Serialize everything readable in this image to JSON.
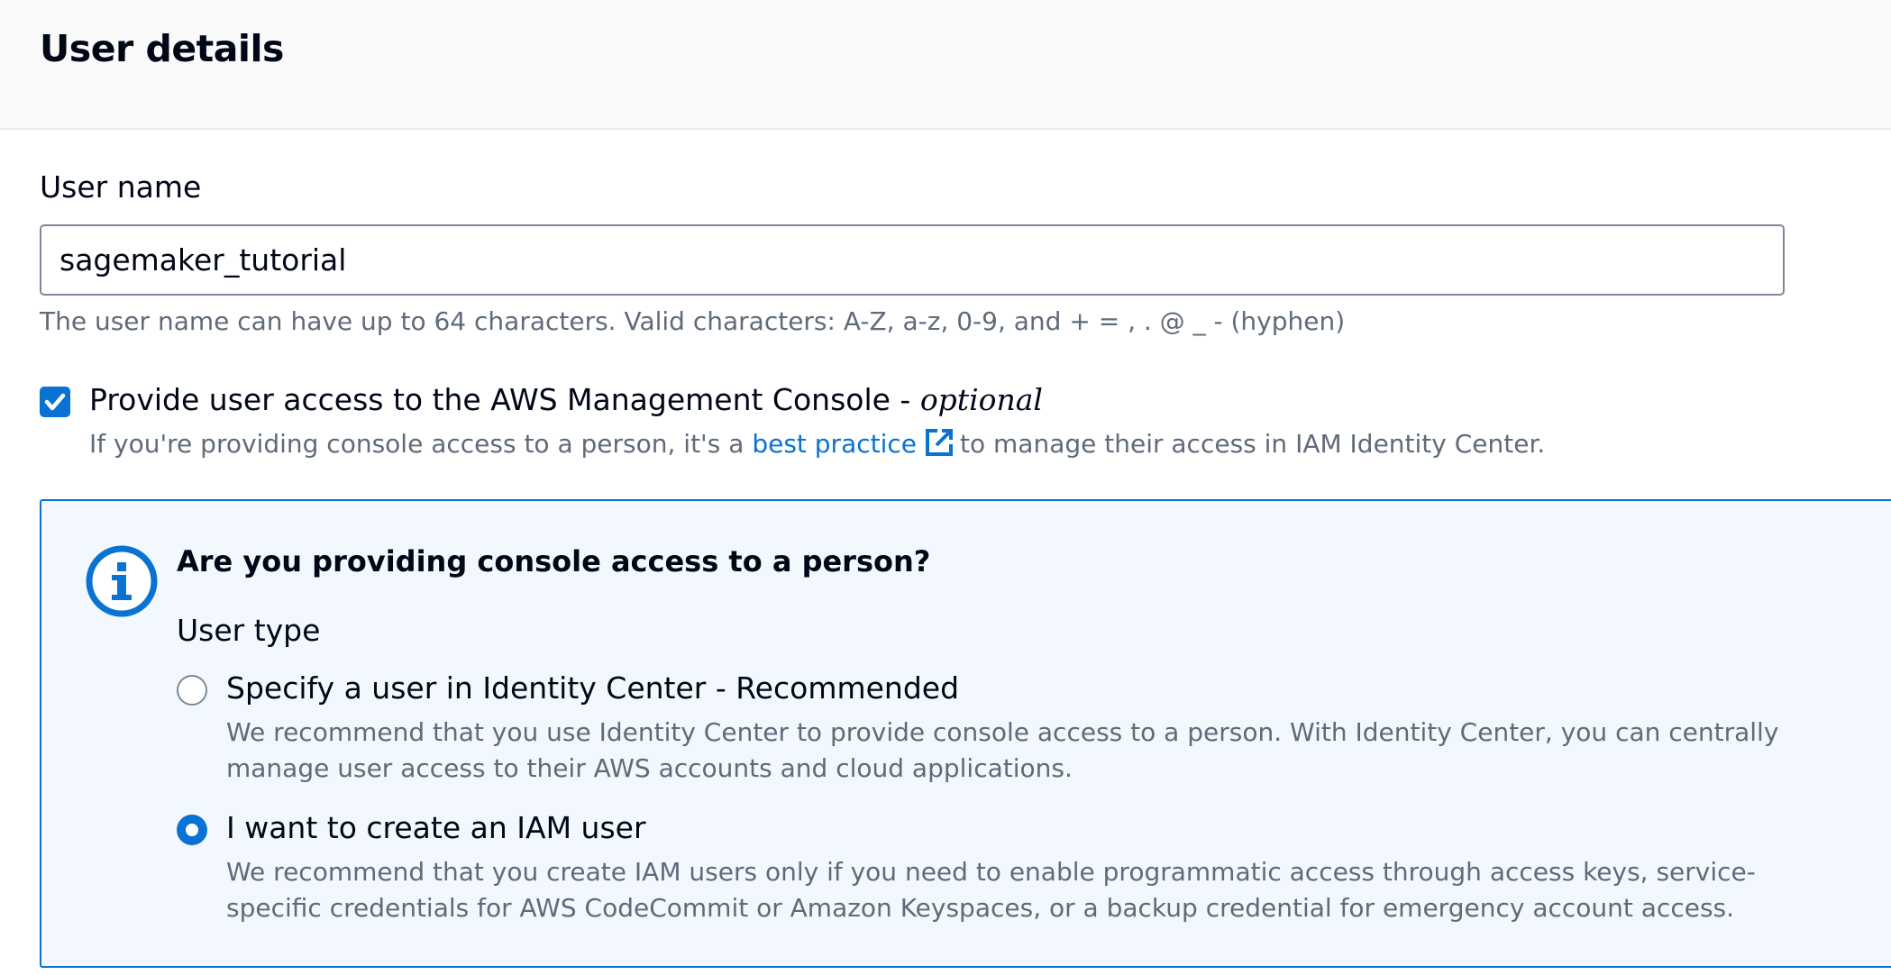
{
  "header": {
    "title": "User details"
  },
  "user_name": {
    "label": "User name",
    "value": "sagemaker_tutorial",
    "hint": "The user name can have up to 64 characters. Valid characters: A-Z, a-z, 0-9, and + = , . @ _ - (hyphen)"
  },
  "console_access": {
    "checked": true,
    "label": "Provide user access to the AWS Management Console - ",
    "label_optional": "optional",
    "desc_before": "If you're providing console access to a person, it's a ",
    "link_text": "best practice",
    "desc_after": "to manage their access in IAM Identity Center."
  },
  "info_box": {
    "title": "Are you providing console access to a person?",
    "user_type_label": "User type",
    "options": [
      {
        "label": "Specify a user in Identity Center - Recommended",
        "desc": "We recommend that you use Identity Center to provide console access to a person. With Identity Center, you can centrally manage user access to their AWS accounts and cloud applications.",
        "selected": false
      },
      {
        "label": "I want to create an IAM user",
        "desc": "We recommend that you create IAM users only if you need to enable programmatic access through access keys, service-specific credentials for AWS CodeCommit or Amazon Keyspaces, or a backup credential for emergency account access.",
        "selected": true
      }
    ]
  },
  "colors": {
    "accent": "#0972d3",
    "muted_text": "#5f6b7a",
    "info_bg": "#f2f8fd"
  }
}
